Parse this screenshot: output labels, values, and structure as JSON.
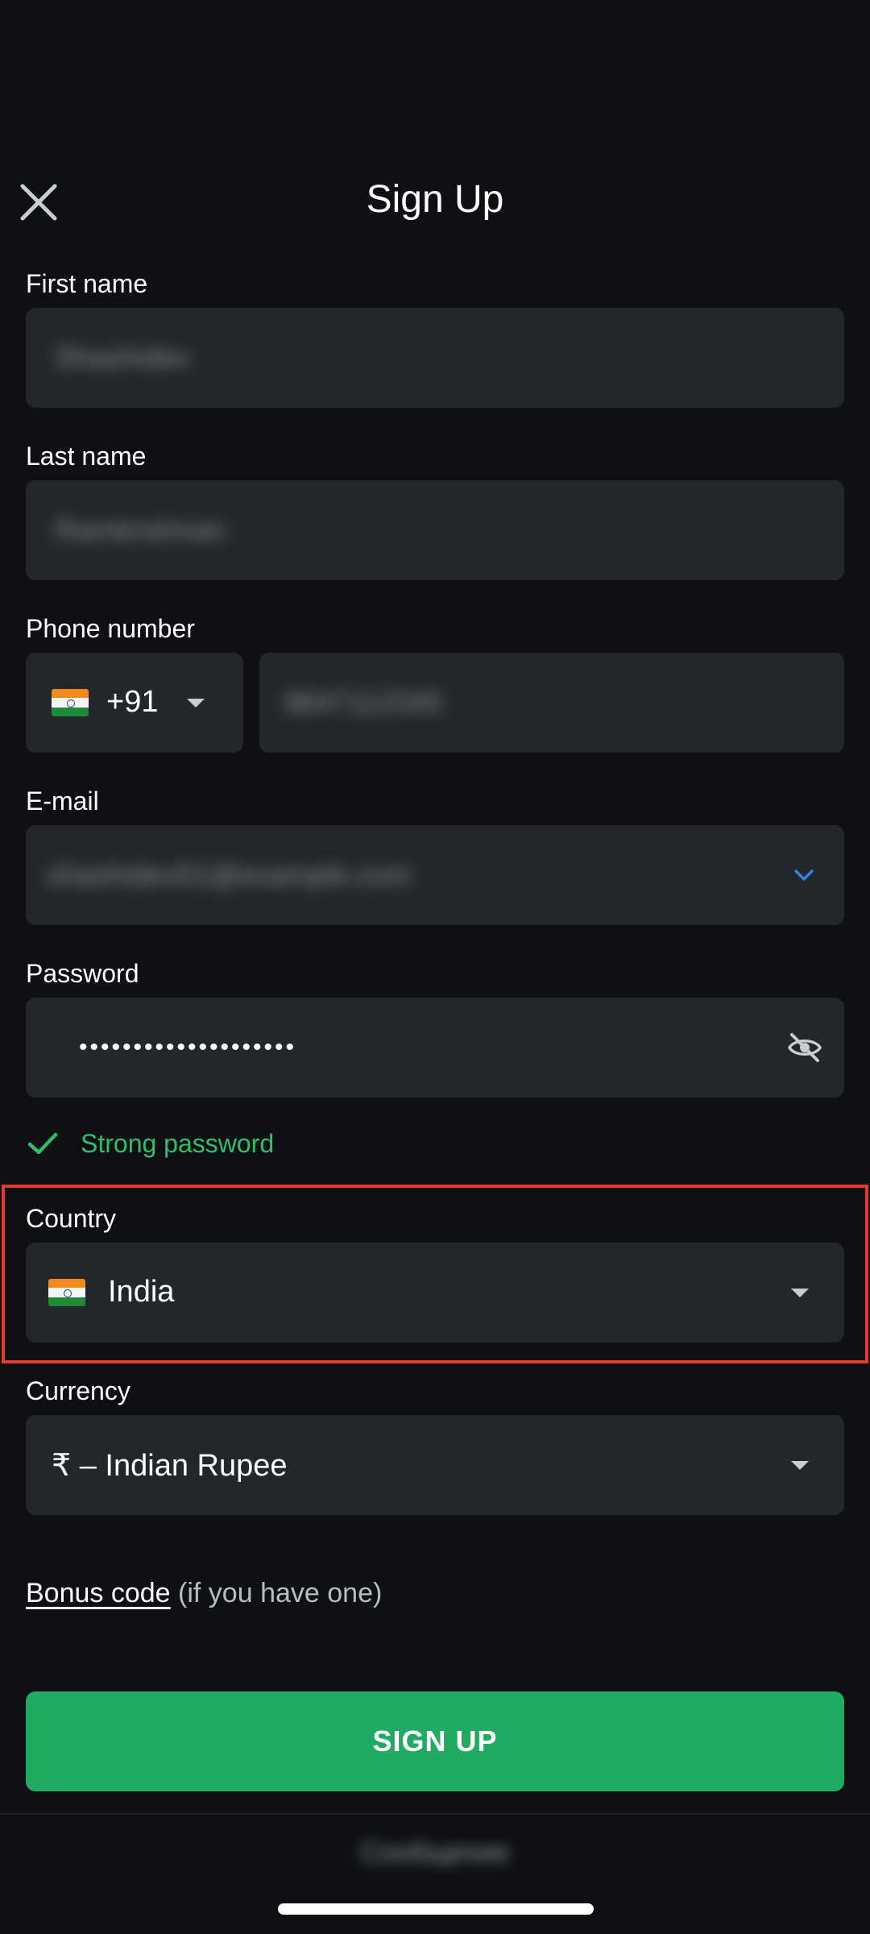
{
  "header": {
    "title": "Sign Up",
    "close_icon": "close-icon"
  },
  "form": {
    "first_name": {
      "label": "First name",
      "value": "Shashidev"
    },
    "last_name": {
      "label": "Last name",
      "value": "Ramkrishnan"
    },
    "phone": {
      "label": "Phone number",
      "code": "+91",
      "number": "9847112345"
    },
    "email": {
      "label": "E-mail",
      "value": "shashidev01@example.com"
    },
    "password": {
      "label": "Password",
      "masked": "••••••••••••••••••••",
      "strength": "Strong password"
    },
    "country": {
      "label": "Country",
      "value": "India"
    },
    "currency": {
      "label": "Currency",
      "value": "₹ – Indian Rupee"
    },
    "bonus": {
      "link": "Bonus code",
      "suffix": " (if you have one)"
    },
    "submit": "SIGN UP"
  },
  "footer": {
    "text": "Сообщение"
  },
  "colors": {
    "accent": "#20aa62",
    "field_bg": "#23262b",
    "highlight": "#e53b2c",
    "success": "#2fbf6b",
    "link_blue": "#2f84e0"
  }
}
